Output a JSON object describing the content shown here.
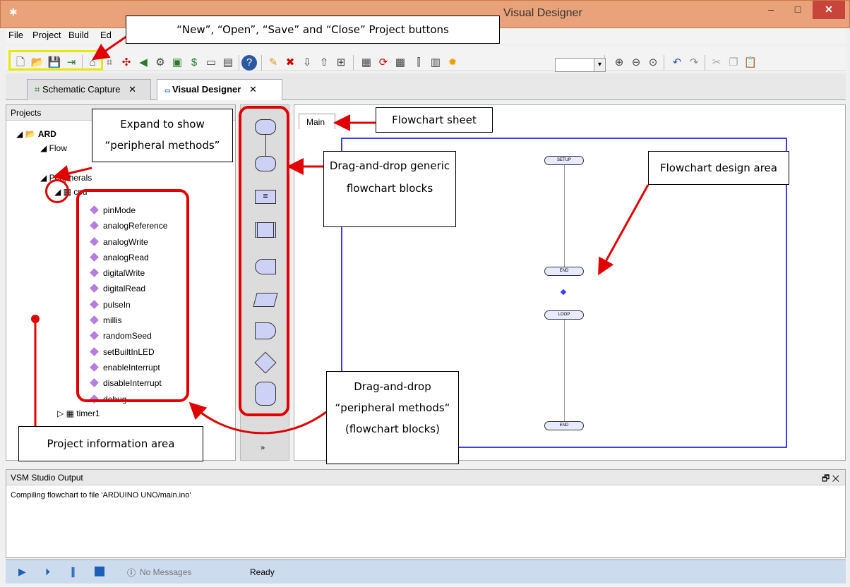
{
  "window": {
    "title": "Visual Designer",
    "controls": [
      "–",
      "□",
      "✕"
    ]
  },
  "menu": [
    "File",
    "Project",
    "Build",
    "Ed"
  ],
  "zoom_value": "",
  "doc_tabs": [
    {
      "label": "Schematic Capture"
    },
    {
      "label": "Visual Designer"
    }
  ],
  "projects": {
    "header": "Projects",
    "root": "ARD",
    "flowchart_node": "Flow",
    "peripherals": "Peripherals",
    "cpu": "cpu",
    "methods": [
      "pinMode",
      "analogReference",
      "analogWrite",
      "analogRead",
      "digitalWrite",
      "digitalRead",
      "pulseIn",
      "millis",
      "randomSeed",
      "setBuiltInLED",
      "enableInterrupt",
      "disableInterrupt",
      "debug"
    ],
    "timer": "timer1"
  },
  "sheet": {
    "tab": "Main",
    "blocks": [
      "SETUP",
      "END",
      "LOOP",
      "END"
    ]
  },
  "output": {
    "header": "VSM Studio Output",
    "message": "Compiling flowchart to file 'ARDUINO UNO/main.ino'"
  },
  "status": {
    "messages": "No Messages",
    "state": "Ready"
  },
  "callouts": {
    "project_buttons": "“New”, “Open”, “Save” and “Close” Project buttons",
    "expand": "Expand to show “peripheral methods”",
    "sheet": "Flowchart sheet",
    "generic": "Drag-and-drop generic flowchart blocks",
    "design": "Flowchart design area",
    "peripheral": "Drag-and-drop “peripheral methods“ (flowchart blocks)",
    "info": "Project information area"
  },
  "colors": {
    "titlebar": "#e9a27a",
    "annotation": "#e00000",
    "highlight": "#e8e800",
    "canvas_border": "#3c3cff",
    "block_fill": "#cdd1f5"
  }
}
